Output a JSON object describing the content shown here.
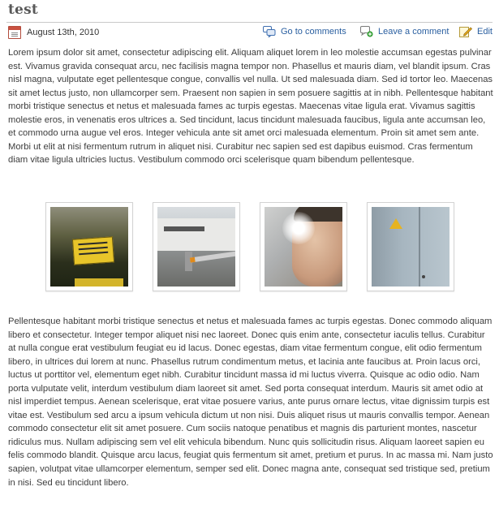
{
  "post": {
    "title": "test",
    "date": "August 13th, 2010",
    "actions": {
      "comments": "Go to comments",
      "leave": "Leave a comment",
      "edit": "Edit"
    },
    "paragraph1": "Lorem ipsum dolor sit amet, consectetur adipiscing elit. Aliquam aliquet lorem in leo molestie accumsan egestas pulvinar est. Vivamus gravida consequat arcu, nec facilisis magna tempor non. Phasellus et mauris diam, vel blandit ipsum. Cras nisl magna, vulputate eget pellentesque congue, convallis vel nulla. Ut sed malesuada diam. Sed id tortor leo. Maecenas sit amet lectus justo, non ullamcorper sem. Praesent non sapien in sem posuere sagittis at in nibh. Pellentesque habitant morbi tristique senectus et netus et malesuada fames ac turpis egestas. Maecenas vitae ligula erat. Vivamus sagittis molestie eros, in venenatis eros ultrices a. Sed tincidunt, lacus tincidunt malesuada faucibus, ligula ante accumsan leo, et commodo urna augue vel eros. Integer vehicula ante sit amet orci malesuada elementum. Proin sit amet sem ante. Morbi ut elit at nisi fermentum rutrum in aliquet nisi. Curabitur nec sapien sed est dapibus euismod. Cras fermentum diam vitae ligula ultricies luctus. Vestibulum commodo orci scelerisque quam bibendum pellentesque.",
    "paragraph2": "Pellentesque habitant morbi tristique senectus et netus et malesuada fames ac turpis egestas. Donec commodo aliquam libero et consectetur. Integer tempor aliquet nisi nec laoreet. Donec quis enim ante, consectetur iaculis tellus. Curabitur at nulla congue erat vestibulum feugiat eu id lacus. Donec egestas, diam vitae fermentum congue, elit odio fermentum libero, in ultrices dui lorem at nunc. Phasellus rutrum condimentum metus, et lacinia ante faucibus at. Proin lacus orci, luctus ut porttitor vel, elementum eget nibh. Curabitur tincidunt massa id mi luctus viverra. Quisque ac odio odio. Nam porta vulputate velit, interdum vestibulum diam laoreet sit amet. Sed porta consequat interdum. Mauris sit amet odio at nisl imperdiet tempus. Aenean scelerisque, erat vitae posuere varius, ante purus ornare lectus, vitae dignissim turpis est vitae est. Vestibulum sed arcu a ipsum vehicula dictum ut non nisi. Duis aliquet risus ut mauris convallis tempor. Aenean commodo consectetur elit sit amet posuere. Cum sociis natoque penatibus et magnis dis parturient montes, nascetur ridiculus mus. Nullam adipiscing sem vel elit vehicula bibendum. Nunc quis sollicitudin risus. Aliquam laoreet sapien eu felis commodo blandit. Quisque arcu lacus, feugiat quis fermentum sit amet, pretium et purus. In ac massa mi. Nam justo sapien, volutpat vitae ullamcorper elementum, semper sed elit. Donec magna ante, consequat sed tristique sed, pretium in nisi. Sed eu tincidunt libero."
  },
  "gallery": {
    "images": [
      {
        "icon": "yellow-parking-sign-photo"
      },
      {
        "icon": "parking-barrier-photo"
      },
      {
        "icon": "man-portrait-photo"
      },
      {
        "icon": "blue-door-warning-sign-photo"
      }
    ]
  },
  "colors": {
    "link": "#2a5fa0",
    "title": "#595959",
    "text": "#3d3d3d"
  }
}
